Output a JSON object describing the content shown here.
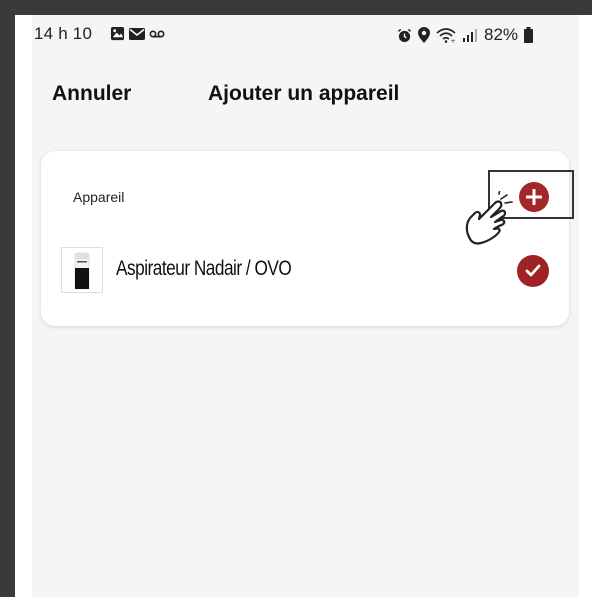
{
  "status_bar": {
    "time": "14 h 10",
    "battery": "82%"
  },
  "header": {
    "cancel_label": "Annuler",
    "title": "Ajouter un appareil"
  },
  "card": {
    "section_label": "Appareil",
    "add_symbol": "+",
    "device": {
      "name": "Aspirateur Nadair / OVO",
      "selected": true
    }
  },
  "colors": {
    "accent": "#a3262a",
    "background": "#f5f5f5",
    "frame": "#3a3a3a"
  },
  "icons": [
    "image-icon",
    "mail-icon",
    "voicemail-icon",
    "alarm-icon",
    "location-icon",
    "wifi-icon",
    "signal-icon",
    "battery-icon",
    "plus-icon",
    "check-icon",
    "hand-pointer-icon"
  ]
}
